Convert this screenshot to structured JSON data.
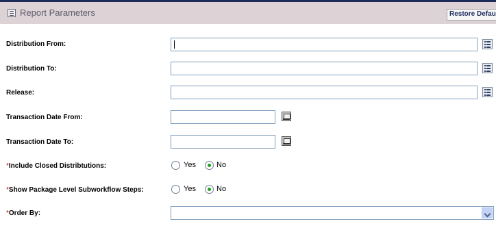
{
  "header": {
    "title": "Report Parameters",
    "restore_label": "Restore Default"
  },
  "fields": {
    "distribution_from": {
      "label": "Distribution From:",
      "value": ""
    },
    "distribution_to": {
      "label": "Distribution To:",
      "value": ""
    },
    "release": {
      "label": "Release:",
      "value": ""
    },
    "transaction_date_from": {
      "label": "Transaction Date From:",
      "value": ""
    },
    "transaction_date_to": {
      "label": "Transaction Date To:",
      "value": ""
    },
    "include_closed": {
      "required_mark": "*",
      "label": "Include Closed Distribtutions:",
      "options": [
        "Yes",
        "No"
      ],
      "selected": "No"
    },
    "show_package_level": {
      "required_mark": "*",
      "label": "Show Package Level Subworkflow Steps:",
      "options": [
        "Yes",
        "No"
      ],
      "selected": "No"
    },
    "order_by": {
      "required_mark": "*",
      "label": "Order By:",
      "value": ""
    }
  },
  "colors": {
    "header_background": "#ddd3d6",
    "header_border": "#1c2b5a",
    "required_mark": "#c00000",
    "radio_selected": "#21a121"
  }
}
